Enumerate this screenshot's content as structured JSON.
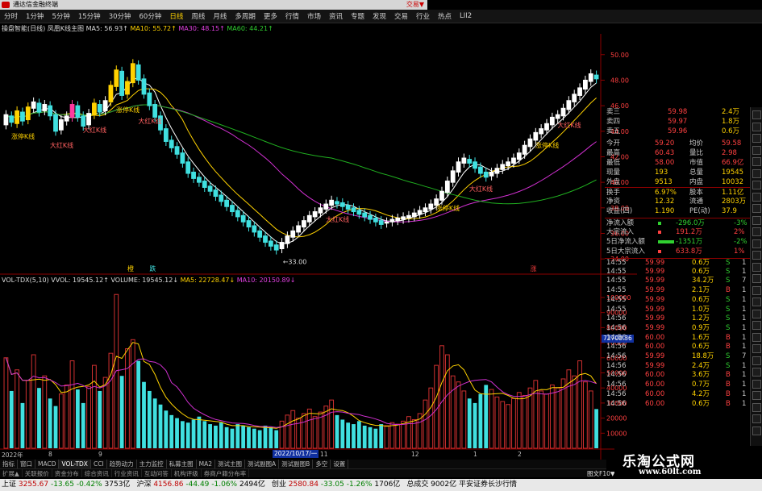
{
  "window": {
    "title": "通达信金融终端",
    "right_label": "交易▼"
  },
  "menubar": {
    "items": [
      "分时",
      "1分钟",
      "5分钟",
      "15分钟",
      "30分钟",
      "60分钟",
      "日线",
      "周线",
      "月线",
      "多周期",
      "更多",
      "行情",
      "市场",
      "资讯",
      "专题",
      "发现",
      "交易",
      "行业",
      "热点",
      "LII2"
    ],
    "active_index": 6
  },
  "main_header": {
    "label": "操盘智能(日线)",
    "indicator": "凤凰K线主图",
    "ma5": "MA5: 56.93↑",
    "ma10": "MA10: 55.72↑",
    "ma30": "MA30: 48.15↑",
    "ma60": "MA60: 44.21↑"
  },
  "vol_header": {
    "label": "VOL-TDX(5,10)",
    "vvol": "VVOL: 19545.12↑",
    "volume": "VOLUME: 19545.12↓",
    "ma5": "MA5: 22728.47↓",
    "ma10": "MA10: 20150.89↓"
  },
  "chart_annotations": {
    "pattern_labels": [
      "涨停K线",
      "大红K线",
      "大红K线",
      "涨停K线",
      "大红K线",
      "大红K线",
      "涨停K线",
      "大红K线",
      "涨停K线",
      "大红K线"
    ],
    "low_label": "33.00",
    "marks": [
      "橙",
      "跌",
      "涨"
    ]
  },
  "chart_data": {
    "type": "candlestick",
    "price_axis": {
      "ticks": [
        "50.00",
        "48.00",
        "46.00",
        "44.00",
        "42.00",
        "40.00",
        "38.00",
        "36.00",
        "34.00"
      ],
      "ylim": [
        33,
        51.5
      ]
    },
    "volume_axis": {
      "ticks": [
        "100000",
        "90000",
        "80000",
        "70000",
        "60000",
        "50000",
        "40000",
        "30000",
        "20000",
        "10000"
      ],
      "ylim": [
        0,
        108000
      ]
    },
    "volume_cursor": "72700.36",
    "x_labels": [
      "2022年",
      "8",
      "9",
      "2022/10/17/一",
      "11",
      "12",
      "1",
      "2"
    ],
    "candles_open": [
      44.5,
      45.2,
      44.6,
      45.5,
      44.9,
      45.8,
      46.2,
      45.6,
      46.0,
      45.3,
      44.1,
      44.8,
      45.1,
      46.0,
      45.2,
      44.5,
      45.3,
      46.1,
      45.6,
      46.3,
      47.5,
      48.7,
      46.9,
      47.8,
      49.2,
      48.1,
      47.0,
      46.1,
      45.2,
      44.2,
      43.3,
      42.8,
      42.3,
      41.6,
      40.8,
      40.4,
      40.1,
      39.7,
      39.4,
      39.0,
      38.6,
      38.2,
      37.8,
      37.4,
      37.0,
      36.6,
      36.2,
      35.8,
      35.4,
      35.1,
      34.8,
      35.2,
      35.7,
      36.1,
      36.5,
      36.9,
      37.3,
      37.6,
      37.9,
      38.2,
      38.5,
      38.4,
      38.2,
      38.0,
      37.8,
      37.6,
      37.4,
      37.2,
      37.0,
      36.8,
      36.9,
      37.0,
      37.1,
      37.2,
      37.3,
      37.5,
      37.7,
      37.9,
      38.2,
      38.6,
      39.2,
      40.0,
      40.8,
      41.5,
      41.8,
      41.6,
      41.2,
      40.8,
      40.5,
      40.7,
      41.0,
      41.3,
      41.5,
      41.8,
      42.2,
      42.8,
      43.3,
      43.8,
      44.1,
      44.5,
      45.0,
      45.2,
      45.7,
      46.3,
      46.8,
      47.3,
      47.9,
      48.4
    ],
    "candles_close": [
      45.3,
      44.7,
      45.6,
      44.8,
      45.9,
      46.3,
      45.5,
      46.1,
      45.2,
      44.0,
      44.9,
      45.2,
      46.1,
      45.1,
      44.4,
      45.4,
      46.2,
      45.5,
      46.4,
      47.6,
      48.8,
      46.8,
      47.9,
      49.3,
      48.0,
      46.9,
      46.0,
      45.1,
      44.1,
      43.2,
      42.7,
      42.2,
      41.5,
      40.7,
      40.3,
      40.0,
      39.6,
      39.3,
      38.9,
      38.5,
      38.1,
      37.7,
      37.3,
      36.9,
      36.5,
      36.1,
      35.7,
      35.3,
      35.0,
      34.7,
      35.3,
      35.8,
      36.2,
      36.6,
      37.0,
      37.4,
      37.7,
      38.0,
      38.3,
      38.6,
      38.3,
      38.1,
      37.9,
      37.7,
      37.5,
      37.3,
      37.1,
      36.9,
      36.7,
      36.9,
      37.1,
      37.2,
      37.3,
      37.4,
      37.6,
      37.8,
      38.0,
      38.3,
      38.7,
      39.3,
      40.1,
      40.9,
      41.6,
      41.9,
      41.5,
      41.1,
      40.7,
      40.4,
      40.8,
      41.1,
      41.4,
      41.6,
      41.9,
      42.3,
      42.9,
      43.4,
      43.9,
      44.2,
      44.6,
      45.1,
      45.3,
      45.8,
      46.4,
      46.9,
      47.4,
      48.0,
      48.5,
      48.1
    ],
    "volume_values": [
      60000,
      38000,
      52000,
      30000,
      45000,
      62000,
      40000,
      48000,
      33000,
      28000,
      36000,
      42000,
      58000,
      39000,
      30000,
      41000,
      55000,
      38000,
      47000,
      63000,
      102000,
      48000,
      66000,
      72000,
      58000,
      44000,
      38000,
      33000,
      29000,
      25000,
      22000,
      20000,
      18000,
      17000,
      19000,
      21000,
      18000,
      16000,
      15000,
      17000,
      14000,
      13000,
      16000,
      15000,
      14000,
      13000,
      12000,
      15000,
      14000,
      12000,
      18000,
      22000,
      25000,
      20000,
      23000,
      26000,
      21000,
      24000,
      28000,
      32000,
      22000,
      19000,
      17000,
      16000,
      18000,
      15000,
      14000,
      13000,
      16000,
      15000,
      17000,
      16000,
      18000,
      21000,
      19000,
      23000,
      32000,
      40000,
      55000,
      68000,
      62000,
      48000,
      44000,
      38000,
      33000,
      30000,
      36000,
      42000,
      39000,
      34000,
      31000,
      29000,
      33000,
      37000,
      35000,
      40000,
      45000,
      38000,
      36000,
      42000,
      40000,
      46000,
      52000,
      48000,
      58000,
      44000,
      38000,
      26000
    ]
  },
  "panel": {
    "quote_top": [
      {
        "label": "卖三",
        "value": "59.98",
        "size": "2.4万"
      },
      {
        "label": "卖四",
        "value": "59.97",
        "size": "1.8万"
      },
      {
        "label": "卖五",
        "value": "59.96",
        "size": "0.6万"
      }
    ],
    "stats": [
      [
        "今开",
        "59.20",
        "均价",
        "59.58"
      ],
      [
        "最高",
        "60.43",
        "量比",
        "2.98"
      ],
      [
        "最低",
        "58.00",
        "市值",
        "66.9亿"
      ],
      [
        "现量",
        "193",
        "总量",
        "19545"
      ],
      [
        "外盘",
        "9513",
        "内盘",
        "10032"
      ],
      [
        "换手",
        "6.97%",
        "股本",
        "1.11亿"
      ],
      [
        "净资",
        "12.32",
        "流通",
        "2803万"
      ],
      [
        "收益(四)",
        "1.190",
        "PE(动)",
        "37.9"
      ]
    ],
    "flows": [
      {
        "label": "净流入额",
        "value": "-296.0万",
        "pct": "-3%"
      },
      {
        "label": "大宗流入",
        "value": "191.2万",
        "pct": "2%"
      },
      {
        "label": "5日净流入额",
        "value": "-1351万",
        "pct": "-2%"
      },
      {
        "label": "5日大宗流入",
        "value": "633.8万",
        "pct": "1%"
      }
    ],
    "ticks": [
      [
        "14:55",
        "59.99",
        "0.6万",
        "S",
        "1"
      ],
      [
        "14:55",
        "59.99",
        "0.6万",
        "S",
        "1"
      ],
      [
        "14:55",
        "59.99",
        "34.2万",
        "S",
        "7"
      ],
      [
        "14:55",
        "59.99",
        "2.1万",
        "B",
        "1"
      ],
      [
        "14:55",
        "59.99",
        "0.6万",
        "S",
        "1"
      ],
      [
        "14:55",
        "59.99",
        "1.0万",
        "S",
        "1"
      ],
      [
        "14:56",
        "59.99",
        "1.2万",
        "S",
        "1"
      ],
      [
        "14:56",
        "59.99",
        "0.9万",
        "S",
        "1"
      ],
      [
        "14:56",
        "60.00",
        "1.6万",
        "B",
        "1"
      ],
      [
        "14:56",
        "60.00",
        "0.6万",
        "B",
        "1"
      ],
      [
        "14:56",
        "59.99",
        "18.8万",
        "S",
        "7"
      ],
      [
        "14:56",
        "59.99",
        "2.4万",
        "S",
        "1"
      ],
      [
        "14:56",
        "60.00",
        "3.6万",
        "B",
        "1"
      ],
      [
        "14:56",
        "60.00",
        "0.7万",
        "B",
        "1"
      ],
      [
        "14:56",
        "60.00",
        "4.2万",
        "B",
        "1"
      ],
      [
        "14:56",
        "60.00",
        "0.6万",
        "B",
        "1"
      ]
    ]
  },
  "bottom_tabs": [
    "指标",
    "窗口",
    "MACD",
    "VOL-TDX",
    "CCI",
    "趋势动力",
    "主力监控",
    "私募主图",
    "MA2",
    "测试主图",
    "测试副图A",
    "测试副图B",
    "多空",
    "设置"
  ],
  "bottom_tabs_active": 3,
  "bottom_tabs2": [
    "扩展▲",
    "关联报价",
    "资金分布",
    "综合资讯",
    "行业资讯",
    "互动问答",
    "机构评级",
    "券商户籍分布率"
  ],
  "bottom_right_tag": "图文F10▼",
  "statusbar": {
    "items": [
      {
        "label": "上证",
        "value": "3255.67",
        "chg": "-13.65",
        "pct": "-0.42%",
        "amount": "3753亿"
      },
      {
        "label": "沪深",
        "value": "4156.86",
        "chg": "-44.49",
        "pct": "-1.06%",
        "amount": "2494亿"
      },
      {
        "label": "创业",
        "value": "2580.84",
        "chg": "-33.05",
        "pct": "-1.26%",
        "amount": "1706亿"
      }
    ],
    "total_label": "总成交",
    "total": "9002亿",
    "tail": "平安证券长沙行情"
  },
  "watermark": {
    "title": "乐淘公式网",
    "url": "www.60lt.com"
  }
}
